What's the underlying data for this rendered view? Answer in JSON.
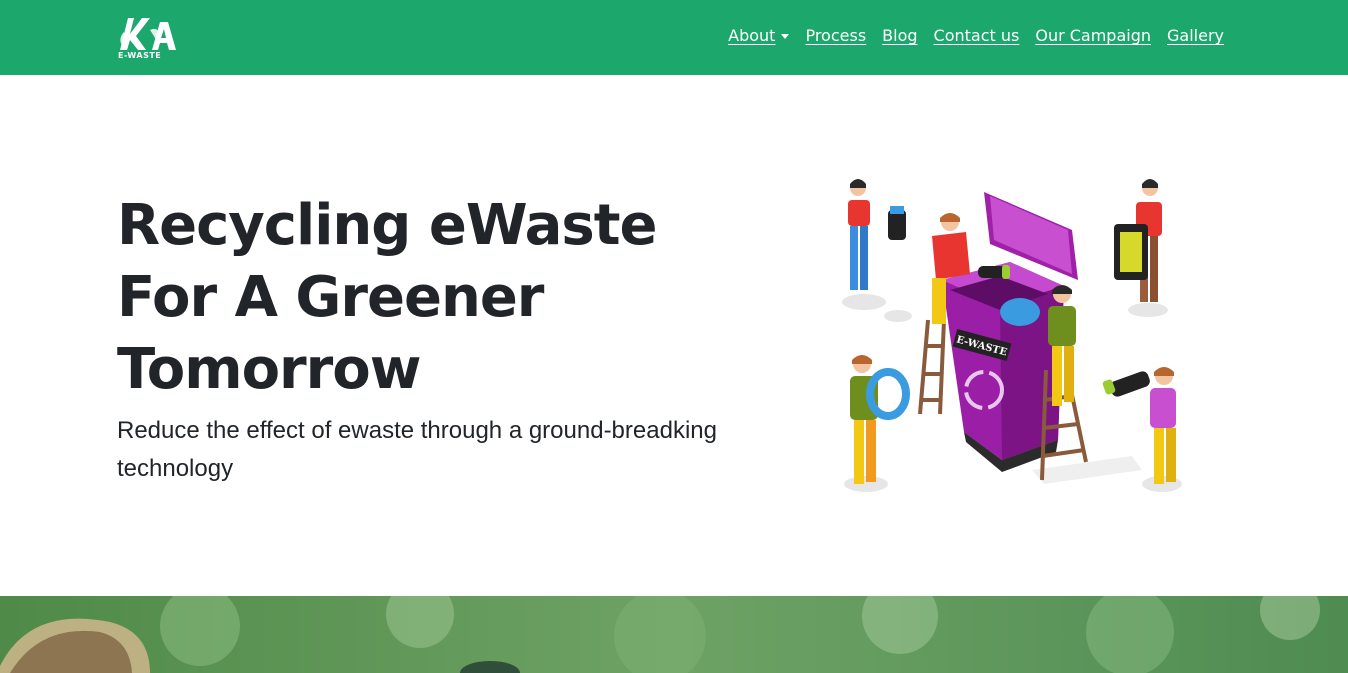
{
  "brand": {
    "logo_text": "E-WASTE",
    "color": "#1ca76c"
  },
  "nav": {
    "items": [
      {
        "label": "About",
        "has_dropdown": true
      },
      {
        "label": "Process"
      },
      {
        "label": "Blog"
      },
      {
        "label": "Contact us"
      },
      {
        "label": "Our Campaign"
      },
      {
        "label": "Gallery"
      }
    ]
  },
  "hero": {
    "title_line1": "Recycling eWaste",
    "title_line2": "For A Greener",
    "title_line3": "Tomorrow",
    "subtitle": "Reduce the effect of ewaste through a ground-breadking technology",
    "bin_label": "E-WASTE"
  }
}
